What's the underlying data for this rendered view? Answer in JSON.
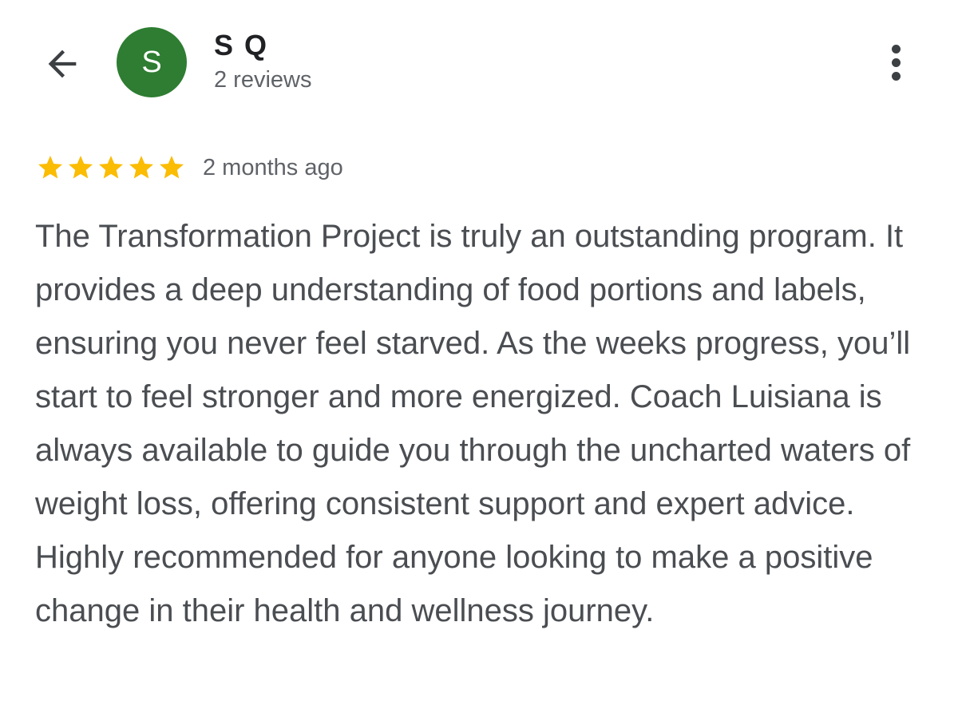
{
  "header": {
    "back_icon": "arrow-left-icon",
    "avatar_letter": "S",
    "avatar_color": "#2e7d32",
    "reviewer_name": "S Q",
    "review_count": "2 reviews",
    "more_icon": "more-vert-icon"
  },
  "review": {
    "rating": 5,
    "rating_max": 5,
    "star_color": "#fbbc04",
    "date": "2 months ago",
    "text": "The Transformation Project is truly an outstanding program. It provides a deep understanding of food portions and labels, ensuring you never feel starved. As the weeks progress, you’ll start to feel stronger and more energized. Coach Luisiana is always available to guide you through the uncharted waters of weight loss, offering consistent support and expert advice. Highly recommended for anyone looking to make a positive change in their health and wellness journey."
  }
}
